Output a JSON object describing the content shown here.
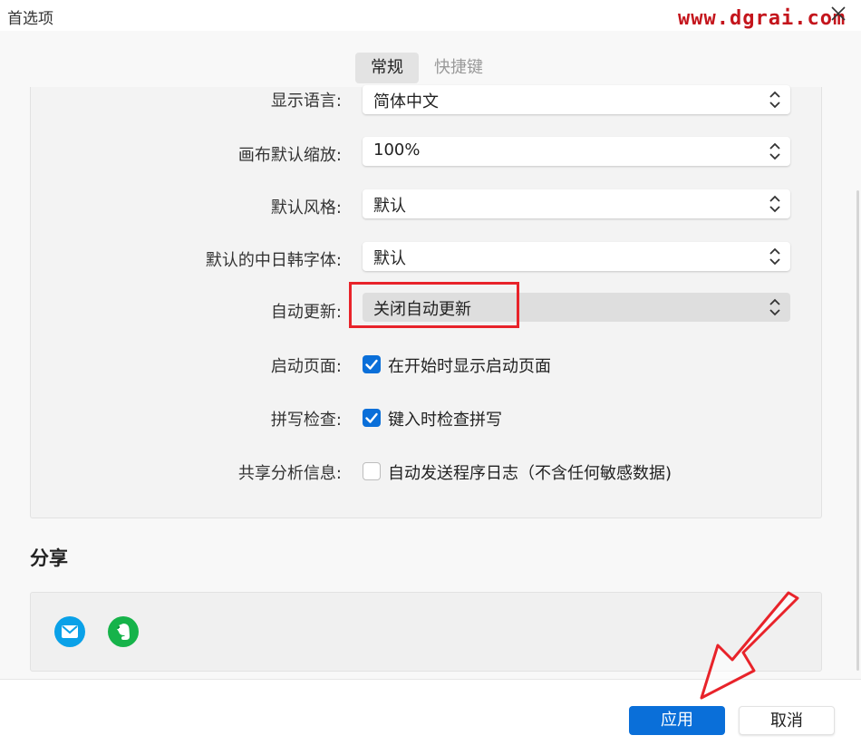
{
  "window": {
    "title": "首选项",
    "watermark": "www.dgrai.com"
  },
  "tabs": [
    {
      "label": "常规",
      "active": true
    },
    {
      "label": "快捷键",
      "active": false
    }
  ],
  "settings": {
    "language": {
      "label": "显示语言:",
      "value": "简体中文"
    },
    "zoom": {
      "label": "画布默认缩放:",
      "value": "100%"
    },
    "style": {
      "label": "默认风格:",
      "value": "默认"
    },
    "cjk_font": {
      "label": "默认的中日韩字体:",
      "value": "默认"
    },
    "auto_update": {
      "label": "自动更新:",
      "value": "关闭自动更新"
    },
    "startup_page": {
      "label": "启动页面:",
      "checkbox_text": "在开始时显示启动页面",
      "checked": true
    },
    "spell_check": {
      "label": "拼写检查:",
      "checkbox_text": "键入时检查拼写",
      "checked": true
    },
    "analytics": {
      "label": "共享分析信息:",
      "checkbox_text": "自动发送程序日志（不含任何敏感数据)",
      "checked": false
    }
  },
  "share": {
    "title": "分享",
    "icons": [
      "mail-icon",
      "evernote-icon"
    ]
  },
  "footer": {
    "apply_label": "应用",
    "cancel_label": "取消"
  },
  "colors": {
    "accent": "#0a6fd9",
    "annotation_red": "#e8232a",
    "mail": "#0aa1e8",
    "evernote": "#16b34a"
  }
}
